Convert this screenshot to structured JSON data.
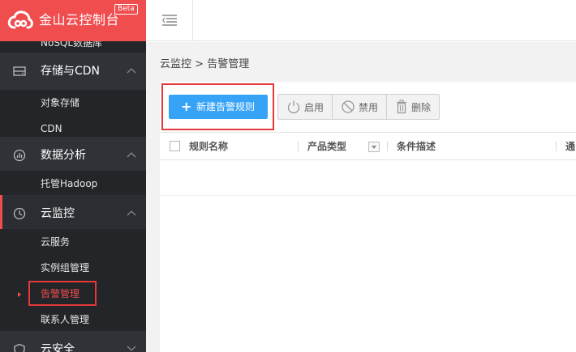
{
  "brand": {
    "title": "金山云控制台",
    "badge": "Beta"
  },
  "sidebar": {
    "partial_item": "NoSQL数据库",
    "groups": [
      {
        "label": "存储与CDN",
        "icon": "storage-icon",
        "items": [
          "对象存储",
          "CDN"
        ]
      },
      {
        "label": "数据分析",
        "icon": "analytics-icon",
        "items": [
          "托管Hadoop"
        ]
      },
      {
        "label": "云监控",
        "icon": "monitor-icon",
        "items": [
          "云服务",
          "实例组管理",
          "告警管理",
          "联系人管理"
        ]
      },
      {
        "label": "云安全",
        "icon": "security-icon",
        "items": []
      }
    ],
    "current_item": "告警管理"
  },
  "breadcrumb": {
    "parent": "云监控",
    "separator": ">",
    "current": "告警管理"
  },
  "toolbar": {
    "new_rule": "新建告警规则",
    "enable": "启用",
    "disable": "禁用",
    "delete": "删除"
  },
  "table": {
    "columns": [
      "规则名称",
      "产品类型",
      "条件描述",
      "通"
    ]
  },
  "colors": {
    "brand": "#f04d4f",
    "primary_button": "#36a3f7",
    "highlight_box": "#e5393b",
    "sidebar_bg": "#2f3237"
  }
}
